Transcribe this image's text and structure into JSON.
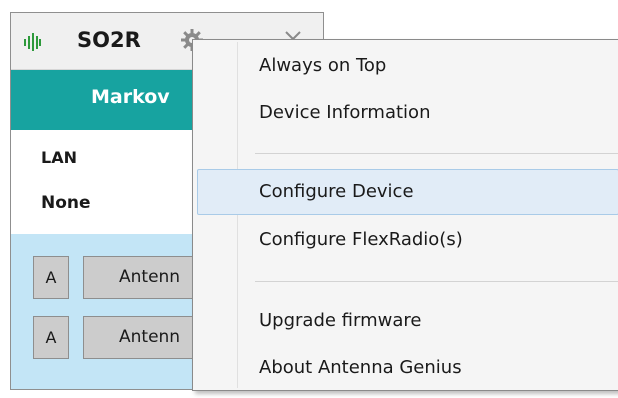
{
  "window": {
    "title": "SO2R",
    "station_name": "Markov",
    "connection_type": "LAN",
    "status": "None"
  },
  "antenna_rows": [
    {
      "port_label": "A",
      "antenna_label": "Antenn"
    },
    {
      "port_label": "A",
      "antenna_label": "Antenn"
    }
  ],
  "context_menu": {
    "items": [
      {
        "label": "Always on Top"
      },
      {
        "label": "Device Information"
      },
      {
        "label": "Configure Device",
        "highlighted": true
      },
      {
        "label": "Configure FlexRadio(s)"
      },
      {
        "label": "Upgrade firmware"
      },
      {
        "label": "About Antenna Genius"
      }
    ]
  },
  "colors": {
    "teal_header": "#17a3a0",
    "antenna_panel": "#c3e5f6",
    "button_gray": "#cccccc",
    "menu_background": "#f5f5f5",
    "menu_highlight": "#e1ecf7",
    "logo_green": "#2e9a3c"
  },
  "icons": {
    "logo": "antenna-genius-logo-icon",
    "settings": "gear-icon",
    "close": "close-icon"
  }
}
